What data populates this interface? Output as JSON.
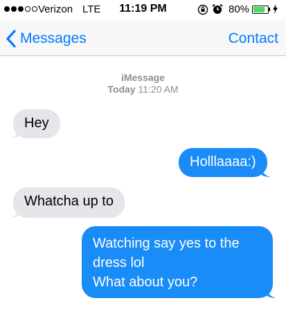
{
  "status_bar": {
    "carrier": "Verizon",
    "network": "LTE",
    "time": "11:19 PM",
    "battery_percent": "80%",
    "battery_level": 0.8
  },
  "nav": {
    "back_label": "Messages",
    "contact_label": "Contact"
  },
  "thread": {
    "service": "iMessage",
    "date_label": "Today",
    "time": "11:20 AM"
  },
  "messages": [
    {
      "direction": "incoming",
      "lines": [
        "Hey"
      ]
    },
    {
      "direction": "outgoing",
      "lines": [
        "Holllaaaa:)"
      ]
    },
    {
      "direction": "incoming",
      "lines": [
        "Whatcha up to"
      ]
    },
    {
      "direction": "outgoing",
      "lines": [
        "Watching say yes to the",
        "dress lol",
        "What about you?"
      ]
    }
  ],
  "colors": {
    "ios_blue": "#007aff",
    "outgoing_bubble": "#1a8cf7",
    "incoming_bubble": "#e5e5ea",
    "battery_green": "#4cd964"
  },
  "icons": [
    "signal-dots-icon",
    "orientation-lock-icon",
    "alarm-clock-icon",
    "battery-icon",
    "charging-bolt-icon",
    "back-chevron-icon"
  ]
}
